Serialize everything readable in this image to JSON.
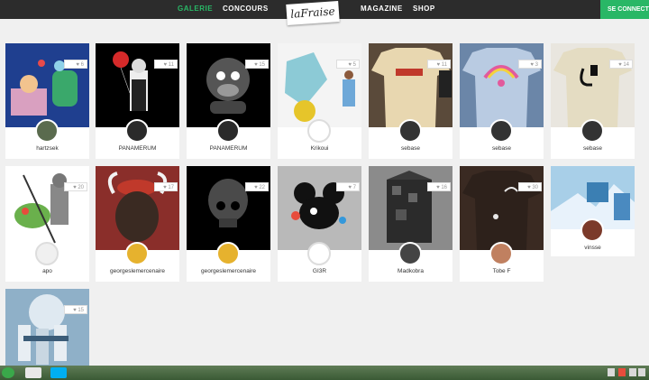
{
  "nav": {
    "galerie": "GALERIE",
    "concours": "CONCOURS",
    "magazine": "MAGAZINE",
    "shop": "SHOP",
    "logo": "laFraise",
    "cta": "SE CONNECT"
  },
  "colors": {
    "accent": "#29b766",
    "topbar": "#2c2c2c"
  },
  "cards": [
    {
      "likes": "6",
      "user": "hartzsek"
    },
    {
      "likes": "11",
      "user": "PANAMERUM"
    },
    {
      "likes": "15",
      "user": "PANAMERUM"
    },
    {
      "likes": "5",
      "user": "Krikoui"
    },
    {
      "likes": "11",
      "user": "sebase"
    },
    {
      "likes": "3",
      "user": "sebase"
    },
    {
      "likes": "14",
      "user": "sebase"
    },
    {
      "likes": "20",
      "user": "apo"
    },
    {
      "likes": "17",
      "user": "georgeslemercenaire"
    },
    {
      "likes": "22",
      "user": "georgeslemercenaire"
    },
    {
      "likes": "7",
      "user": "GI3R"
    },
    {
      "likes": "16",
      "user": "Madkobra"
    },
    {
      "likes": "30",
      "user": "Tobe F"
    },
    {
      "likes": "",
      "user": "vinsse"
    },
    {
      "likes": "15",
      "user": ""
    }
  ]
}
